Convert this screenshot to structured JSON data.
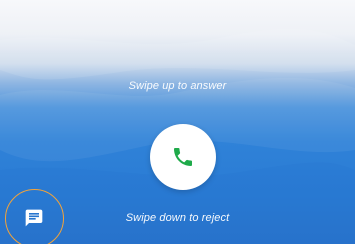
{
  "incoming_call": {
    "swipe_up_hint": "Swipe up to answer",
    "swipe_down_hint": "Swipe down to reject",
    "answer_icon": "phone-icon",
    "message_icon": "message-icon"
  },
  "colors": {
    "answer_icon_green": "#1faa4a",
    "highlight_ring": "#f2a33a",
    "background_blue": "#2f82d8"
  }
}
